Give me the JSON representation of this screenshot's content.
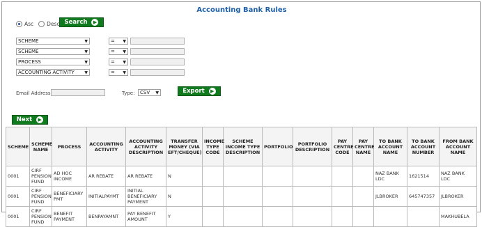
{
  "page_title": "Accounting Bank Rules",
  "sort": {
    "asc_label": "Asc",
    "desc_label": "Desc",
    "selected": "Asc"
  },
  "search_label": "Search",
  "filters": [
    {
      "field": "SCHEME",
      "operator": "=",
      "value": ""
    },
    {
      "field": "SCHEME",
      "operator": "=",
      "value": ""
    },
    {
      "field": "PROCESS",
      "operator": "=",
      "value": ""
    },
    {
      "field": "ACCOUNTING ACTIVITY",
      "operator": "=",
      "value": ""
    }
  ],
  "email_label": "Email Address:",
  "email_value": "",
  "type_label": "Type:",
  "type_value": "CSV",
  "export_label": "Export",
  "next_label": "Next",
  "table": {
    "headers": [
      "SCHEME",
      "SCHEME NAME",
      "PROCESS",
      "ACCOUNTING ACTIVITY",
      "ACCOUNTING ACTIVITY DESCRIPTION",
      "TRANSFER MONEY (VIA EFT/CHEQUE)",
      "INCOME TYPE CODE",
      "SCHEME INCOME TYPE DESCRIPTION",
      "PORTFOLIO",
      "PORTFOLIO DESCRIPTION",
      "PAY CENTRE CODE",
      "PAY CENTRE NAME",
      "TO BANK ACCOUNT NAME",
      "TO BANK ACCOUNT NUMBER",
      "FROM BANK ACCOUNT NAME"
    ],
    "rows": [
      [
        "0001",
        "CIRF PENSION FUND",
        "AD HOC INCOME",
        "AR REBATE",
        "AR REBATE",
        "N",
        "",
        "",
        "",
        "",
        "",
        "",
        "NAZ BANK LDC",
        "1621514",
        "NAZ BANK LDC"
      ],
      [
        "0001",
        "CIRF PENSION FUND",
        "BENEFICIARY PMT",
        "INITIALPAYMT",
        "INITIAL BENEFICIARY PAYMENT",
        "N",
        "",
        "",
        "",
        "",
        "",
        "",
        "JLBROKER",
        "645747357",
        "JLBROKER"
      ],
      [
        "0001",
        "CIRF PENSION FUND",
        "BENEFIT PAYMENT",
        "BENPAYAMNT",
        "PAY BENEFIT AMOUNT",
        "Y",
        "",
        "",
        "",
        "",
        "",
        "",
        "",
        "",
        "MAKHUBELA"
      ]
    ]
  }
}
